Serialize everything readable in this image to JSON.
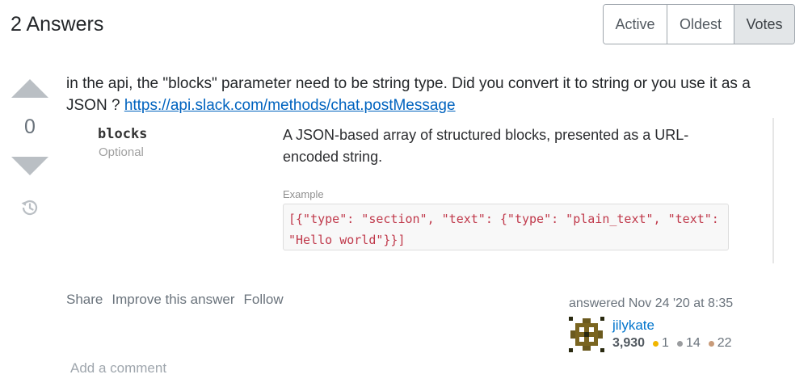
{
  "header": {
    "answers_count_label": "2 Answers",
    "sort_options": [
      "Active",
      "Oldest",
      "Votes"
    ],
    "selected_sort": "Votes"
  },
  "answer": {
    "vote_count": "0",
    "text_before_link": "in the api, the \"blocks\" parameter need to be string type. Did you convert it to string or you use it as a JSON ? ",
    "link_text": "https://api.slack.com/methods/chat.postMessage",
    "embedded_doc": {
      "param_name": "blocks",
      "param_required": "Optional",
      "param_description": "A JSON-based array of structured blocks, presented as a URL-encoded string.",
      "example_label": "Example",
      "example_code": "[{\"type\": \"section\", \"text\": {\"type\": \"plain_text\", \"text\": \"Hello world\"}}]"
    },
    "menu": {
      "share": "Share",
      "improve": "Improve this answer",
      "follow": "Follow"
    },
    "author": {
      "answered_time": "answered Nov 24 '20 at 8:35",
      "name": "jilykate",
      "reputation": "3,930",
      "gold_badges": "1",
      "silver_badges": "14",
      "bronze_badges": "22"
    },
    "add_comment": "Add a comment"
  },
  "colors": {
    "link": "#0063bf",
    "username": "#0074cc",
    "gold": "#f1b600",
    "silver": "#9a9c9f",
    "bronze": "#c89b7a",
    "code": "#c0394b"
  },
  "icons": {
    "vote_up": "up-arrow-icon",
    "vote_down": "down-arrow-icon",
    "history": "history-icon"
  }
}
